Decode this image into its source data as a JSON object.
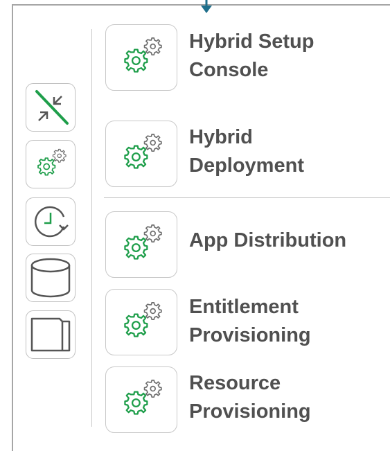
{
  "sidebar": {
    "items": [
      {
        "id": "shrink",
        "icon": "collapse-arrows-icon"
      },
      {
        "id": "settings",
        "icon": "gears-icon"
      },
      {
        "id": "history",
        "icon": "clock-refresh-icon"
      },
      {
        "id": "database",
        "icon": "database-icon"
      },
      {
        "id": "folder",
        "icon": "folder-icon"
      }
    ]
  },
  "features": [
    {
      "icon": "gears-icon",
      "lines": [
        "Hybrid Setup",
        "Console"
      ]
    },
    {
      "icon": "gears-icon",
      "lines": [
        "Hybrid",
        "Deployment"
      ]
    },
    {
      "icon": "gears-icon",
      "lines": [
        "App Distribution"
      ]
    },
    {
      "icon": "gears-icon",
      "lines": [
        "Entitlement",
        "Provisioning"
      ]
    },
    {
      "icon": "gears-icon",
      "lines": [
        "Resource",
        "Provisioning"
      ]
    }
  ],
  "colors": {
    "accent_green": "#1e9e4a",
    "connector_blue": "#1f6f8b",
    "text_gray": "#505050",
    "border_gray": "#c0c0c0"
  }
}
